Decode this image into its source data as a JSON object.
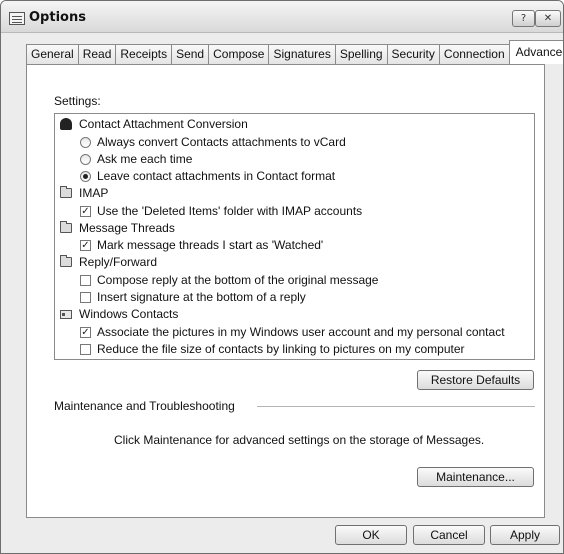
{
  "window": {
    "title": "Options",
    "help_label": "?",
    "close_label": "✕"
  },
  "tabs": [
    {
      "label": "General"
    },
    {
      "label": "Read"
    },
    {
      "label": "Receipts"
    },
    {
      "label": "Send"
    },
    {
      "label": "Compose"
    },
    {
      "label": "Signatures"
    },
    {
      "label": "Spelling"
    },
    {
      "label": "Security"
    },
    {
      "label": "Connection"
    },
    {
      "label": "Advanced",
      "active": true
    }
  ],
  "settings": {
    "label": "Settings:",
    "groups": {
      "contact_conversion": {
        "label": "Contact Attachment Conversion",
        "options": [
          {
            "label": "Always convert Contacts attachments to vCard",
            "selected": false
          },
          {
            "label": "Ask me each time",
            "selected": false
          },
          {
            "label": "Leave contact attachments in Contact format",
            "selected": true
          }
        ]
      },
      "imap": {
        "label": "IMAP",
        "options": [
          {
            "label": "Use the 'Deleted Items' folder with IMAP accounts",
            "checked": true
          }
        ]
      },
      "message_threads": {
        "label": "Message Threads",
        "options": [
          {
            "label": "Mark message threads I start as 'Watched'",
            "checked": true
          }
        ]
      },
      "reply_forward": {
        "label": "Reply/Forward",
        "options": [
          {
            "label": "Compose reply at the bottom of the original message",
            "checked": false
          },
          {
            "label": "Insert signature at the bottom of a reply",
            "checked": false
          }
        ]
      },
      "windows_contacts": {
        "label": "Windows Contacts",
        "options": [
          {
            "label": "Associate the pictures in my Windows user account and my personal contact",
            "checked": true
          },
          {
            "label": "Reduce the file size of contacts by linking to pictures on my computer",
            "checked": false
          }
        ]
      }
    },
    "restore_label": "Restore Defaults"
  },
  "maintenance": {
    "heading": "Maintenance and Troubleshooting",
    "description": "Click Maintenance for advanced settings on the storage of Messages.",
    "button_label": "Maintenance..."
  },
  "footer": {
    "ok_label": "OK",
    "cancel_label": "Cancel",
    "apply_label": "Apply"
  },
  "checkmark": "✓"
}
